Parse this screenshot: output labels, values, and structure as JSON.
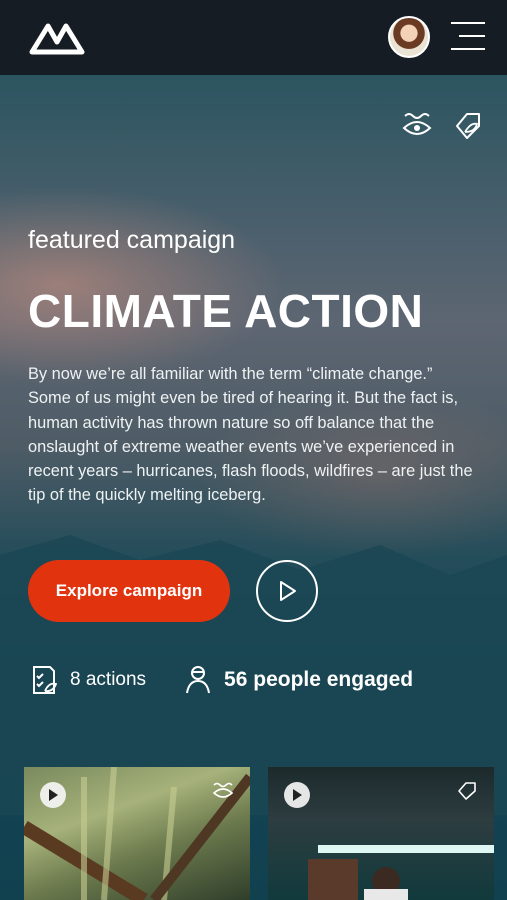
{
  "header": {
    "logo_icon": "brand-logo-icon",
    "avatar_icon": "user-avatar",
    "menu_icon": "hamburger-menu-icon"
  },
  "hero": {
    "icons": [
      "eye-waves-icon",
      "leaf-tag-icon"
    ],
    "kicker": "featured campaign",
    "title": "CLIMATE ACTION",
    "body": "By now we’re all familiar with the term “climate change.” Some of us might even be tired of hearing it. But the fact is, human activity has thrown nature so off balance that the onslaught of extreme weather events we’ve experienced in recent years – hurricanes, flash floods, wildfires – are just the tip of the quickly melting iceberg.",
    "explore_label": "Explore campaign",
    "accent_color": "#e2330f"
  },
  "stats": {
    "actions": "8 actions",
    "engaged": "56 people engaged"
  },
  "cards": [
    {
      "play_icon": "play-icon",
      "corner_icon": "eye-waves-icon"
    },
    {
      "play_icon": "play-icon",
      "corner_icon": "leaf-tag-icon"
    }
  ]
}
